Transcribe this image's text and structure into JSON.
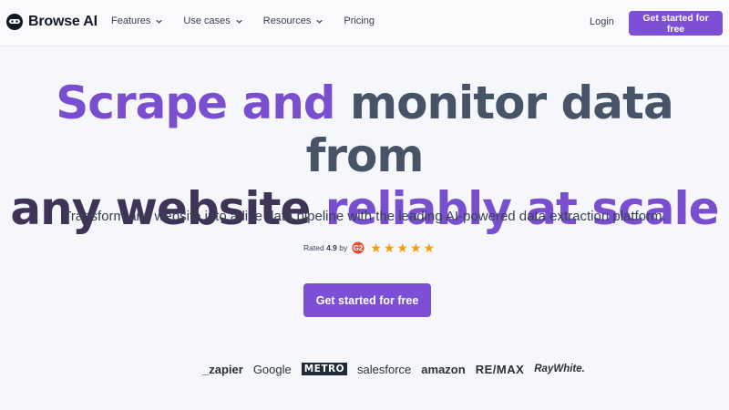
{
  "header": {
    "brand_name": "Browse AI",
    "nav": [
      {
        "label": "Features",
        "has_dropdown": true
      },
      {
        "label": "Use cases",
        "has_dropdown": true
      },
      {
        "label": "Resources",
        "has_dropdown": true
      },
      {
        "label": "Pricing",
        "has_dropdown": false
      }
    ],
    "login_label": "Login",
    "cta_label": "Get started for free"
  },
  "hero": {
    "title_line1_part1": "Scrape and",
    "title_line1_part2": "monitor data from",
    "title_line2_part1": "any website",
    "title_line2_part2": "reliably at scale",
    "subtitle": "Transform any website into a live data pipeline with the leading AI-powered data extraction platform.",
    "rating_prefix": "Rated",
    "rating_value": "4.9",
    "rating_suffix": "by",
    "rating_stars": 5,
    "cta_label": "Get started for free"
  },
  "trusted_logos": [
    "_zapier",
    "Google",
    "METRO",
    "salesforce",
    "amazon",
    "RE/MAX",
    "RayWhite."
  ],
  "colors": {
    "accent": "#7c4fd6",
    "title_purple": "#7a4fcf",
    "title_slate": "#475467",
    "title_dark": "#3f3358",
    "star": "#f59e0b",
    "background": "#f6f7fb"
  }
}
